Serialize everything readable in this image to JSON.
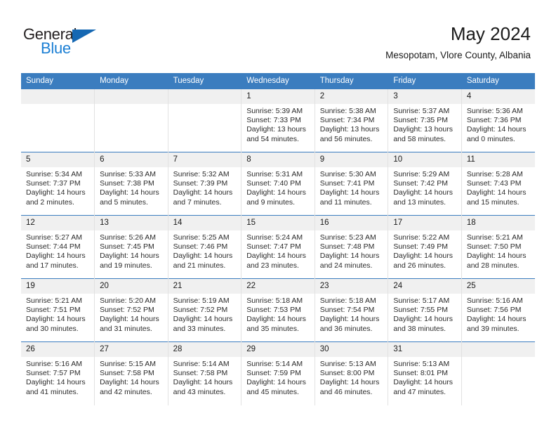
{
  "brand": {
    "name_part1": "General",
    "name_part2": "Blue",
    "triangle_icon": "triangle-icon",
    "accent_color": "#1668b3",
    "text_color": "#231f20"
  },
  "header": {
    "month_title": "May 2024",
    "location": "Mesopotam, Vlore County, Albania"
  },
  "calendar": {
    "header_bg": "#3b7dbf",
    "daynum_bg": "#f0f0f0",
    "weekdays": [
      "Sunday",
      "Monday",
      "Tuesday",
      "Wednesday",
      "Thursday",
      "Friday",
      "Saturday"
    ],
    "weeks": [
      [
        {
          "day": "",
          "empty": true
        },
        {
          "day": "",
          "empty": true
        },
        {
          "day": "",
          "empty": true
        },
        {
          "day": "1",
          "sunrise": "Sunrise: 5:39 AM",
          "sunset": "Sunset: 7:33 PM",
          "daylight": "Daylight: 13 hours and 54 minutes."
        },
        {
          "day": "2",
          "sunrise": "Sunrise: 5:38 AM",
          "sunset": "Sunset: 7:34 PM",
          "daylight": "Daylight: 13 hours and 56 minutes."
        },
        {
          "day": "3",
          "sunrise": "Sunrise: 5:37 AM",
          "sunset": "Sunset: 7:35 PM",
          "daylight": "Daylight: 13 hours and 58 minutes."
        },
        {
          "day": "4",
          "sunrise": "Sunrise: 5:36 AM",
          "sunset": "Sunset: 7:36 PM",
          "daylight": "Daylight: 14 hours and 0 minutes."
        }
      ],
      [
        {
          "day": "5",
          "sunrise": "Sunrise: 5:34 AM",
          "sunset": "Sunset: 7:37 PM",
          "daylight": "Daylight: 14 hours and 2 minutes."
        },
        {
          "day": "6",
          "sunrise": "Sunrise: 5:33 AM",
          "sunset": "Sunset: 7:38 PM",
          "daylight": "Daylight: 14 hours and 5 minutes."
        },
        {
          "day": "7",
          "sunrise": "Sunrise: 5:32 AM",
          "sunset": "Sunset: 7:39 PM",
          "daylight": "Daylight: 14 hours and 7 minutes."
        },
        {
          "day": "8",
          "sunrise": "Sunrise: 5:31 AM",
          "sunset": "Sunset: 7:40 PM",
          "daylight": "Daylight: 14 hours and 9 minutes."
        },
        {
          "day": "9",
          "sunrise": "Sunrise: 5:30 AM",
          "sunset": "Sunset: 7:41 PM",
          "daylight": "Daylight: 14 hours and 11 minutes."
        },
        {
          "day": "10",
          "sunrise": "Sunrise: 5:29 AM",
          "sunset": "Sunset: 7:42 PM",
          "daylight": "Daylight: 14 hours and 13 minutes."
        },
        {
          "day": "11",
          "sunrise": "Sunrise: 5:28 AM",
          "sunset": "Sunset: 7:43 PM",
          "daylight": "Daylight: 14 hours and 15 minutes."
        }
      ],
      [
        {
          "day": "12",
          "sunrise": "Sunrise: 5:27 AM",
          "sunset": "Sunset: 7:44 PM",
          "daylight": "Daylight: 14 hours and 17 minutes."
        },
        {
          "day": "13",
          "sunrise": "Sunrise: 5:26 AM",
          "sunset": "Sunset: 7:45 PM",
          "daylight": "Daylight: 14 hours and 19 minutes."
        },
        {
          "day": "14",
          "sunrise": "Sunrise: 5:25 AM",
          "sunset": "Sunset: 7:46 PM",
          "daylight": "Daylight: 14 hours and 21 minutes."
        },
        {
          "day": "15",
          "sunrise": "Sunrise: 5:24 AM",
          "sunset": "Sunset: 7:47 PM",
          "daylight": "Daylight: 14 hours and 23 minutes."
        },
        {
          "day": "16",
          "sunrise": "Sunrise: 5:23 AM",
          "sunset": "Sunset: 7:48 PM",
          "daylight": "Daylight: 14 hours and 24 minutes."
        },
        {
          "day": "17",
          "sunrise": "Sunrise: 5:22 AM",
          "sunset": "Sunset: 7:49 PM",
          "daylight": "Daylight: 14 hours and 26 minutes."
        },
        {
          "day": "18",
          "sunrise": "Sunrise: 5:21 AM",
          "sunset": "Sunset: 7:50 PM",
          "daylight": "Daylight: 14 hours and 28 minutes."
        }
      ],
      [
        {
          "day": "19",
          "sunrise": "Sunrise: 5:21 AM",
          "sunset": "Sunset: 7:51 PM",
          "daylight": "Daylight: 14 hours and 30 minutes."
        },
        {
          "day": "20",
          "sunrise": "Sunrise: 5:20 AM",
          "sunset": "Sunset: 7:52 PM",
          "daylight": "Daylight: 14 hours and 31 minutes."
        },
        {
          "day": "21",
          "sunrise": "Sunrise: 5:19 AM",
          "sunset": "Sunset: 7:52 PM",
          "daylight": "Daylight: 14 hours and 33 minutes."
        },
        {
          "day": "22",
          "sunrise": "Sunrise: 5:18 AM",
          "sunset": "Sunset: 7:53 PM",
          "daylight": "Daylight: 14 hours and 35 minutes."
        },
        {
          "day": "23",
          "sunrise": "Sunrise: 5:18 AM",
          "sunset": "Sunset: 7:54 PM",
          "daylight": "Daylight: 14 hours and 36 minutes."
        },
        {
          "day": "24",
          "sunrise": "Sunrise: 5:17 AM",
          "sunset": "Sunset: 7:55 PM",
          "daylight": "Daylight: 14 hours and 38 minutes."
        },
        {
          "day": "25",
          "sunrise": "Sunrise: 5:16 AM",
          "sunset": "Sunset: 7:56 PM",
          "daylight": "Daylight: 14 hours and 39 minutes."
        }
      ],
      [
        {
          "day": "26",
          "sunrise": "Sunrise: 5:16 AM",
          "sunset": "Sunset: 7:57 PM",
          "daylight": "Daylight: 14 hours and 41 minutes."
        },
        {
          "day": "27",
          "sunrise": "Sunrise: 5:15 AM",
          "sunset": "Sunset: 7:58 PM",
          "daylight": "Daylight: 14 hours and 42 minutes."
        },
        {
          "day": "28",
          "sunrise": "Sunrise: 5:14 AM",
          "sunset": "Sunset: 7:58 PM",
          "daylight": "Daylight: 14 hours and 43 minutes."
        },
        {
          "day": "29",
          "sunrise": "Sunrise: 5:14 AM",
          "sunset": "Sunset: 7:59 PM",
          "daylight": "Daylight: 14 hours and 45 minutes."
        },
        {
          "day": "30",
          "sunrise": "Sunrise: 5:13 AM",
          "sunset": "Sunset: 8:00 PM",
          "daylight": "Daylight: 14 hours and 46 minutes."
        },
        {
          "day": "31",
          "sunrise": "Sunrise: 5:13 AM",
          "sunset": "Sunset: 8:01 PM",
          "daylight": "Daylight: 14 hours and 47 minutes."
        },
        {
          "day": "",
          "empty": true
        }
      ]
    ]
  }
}
